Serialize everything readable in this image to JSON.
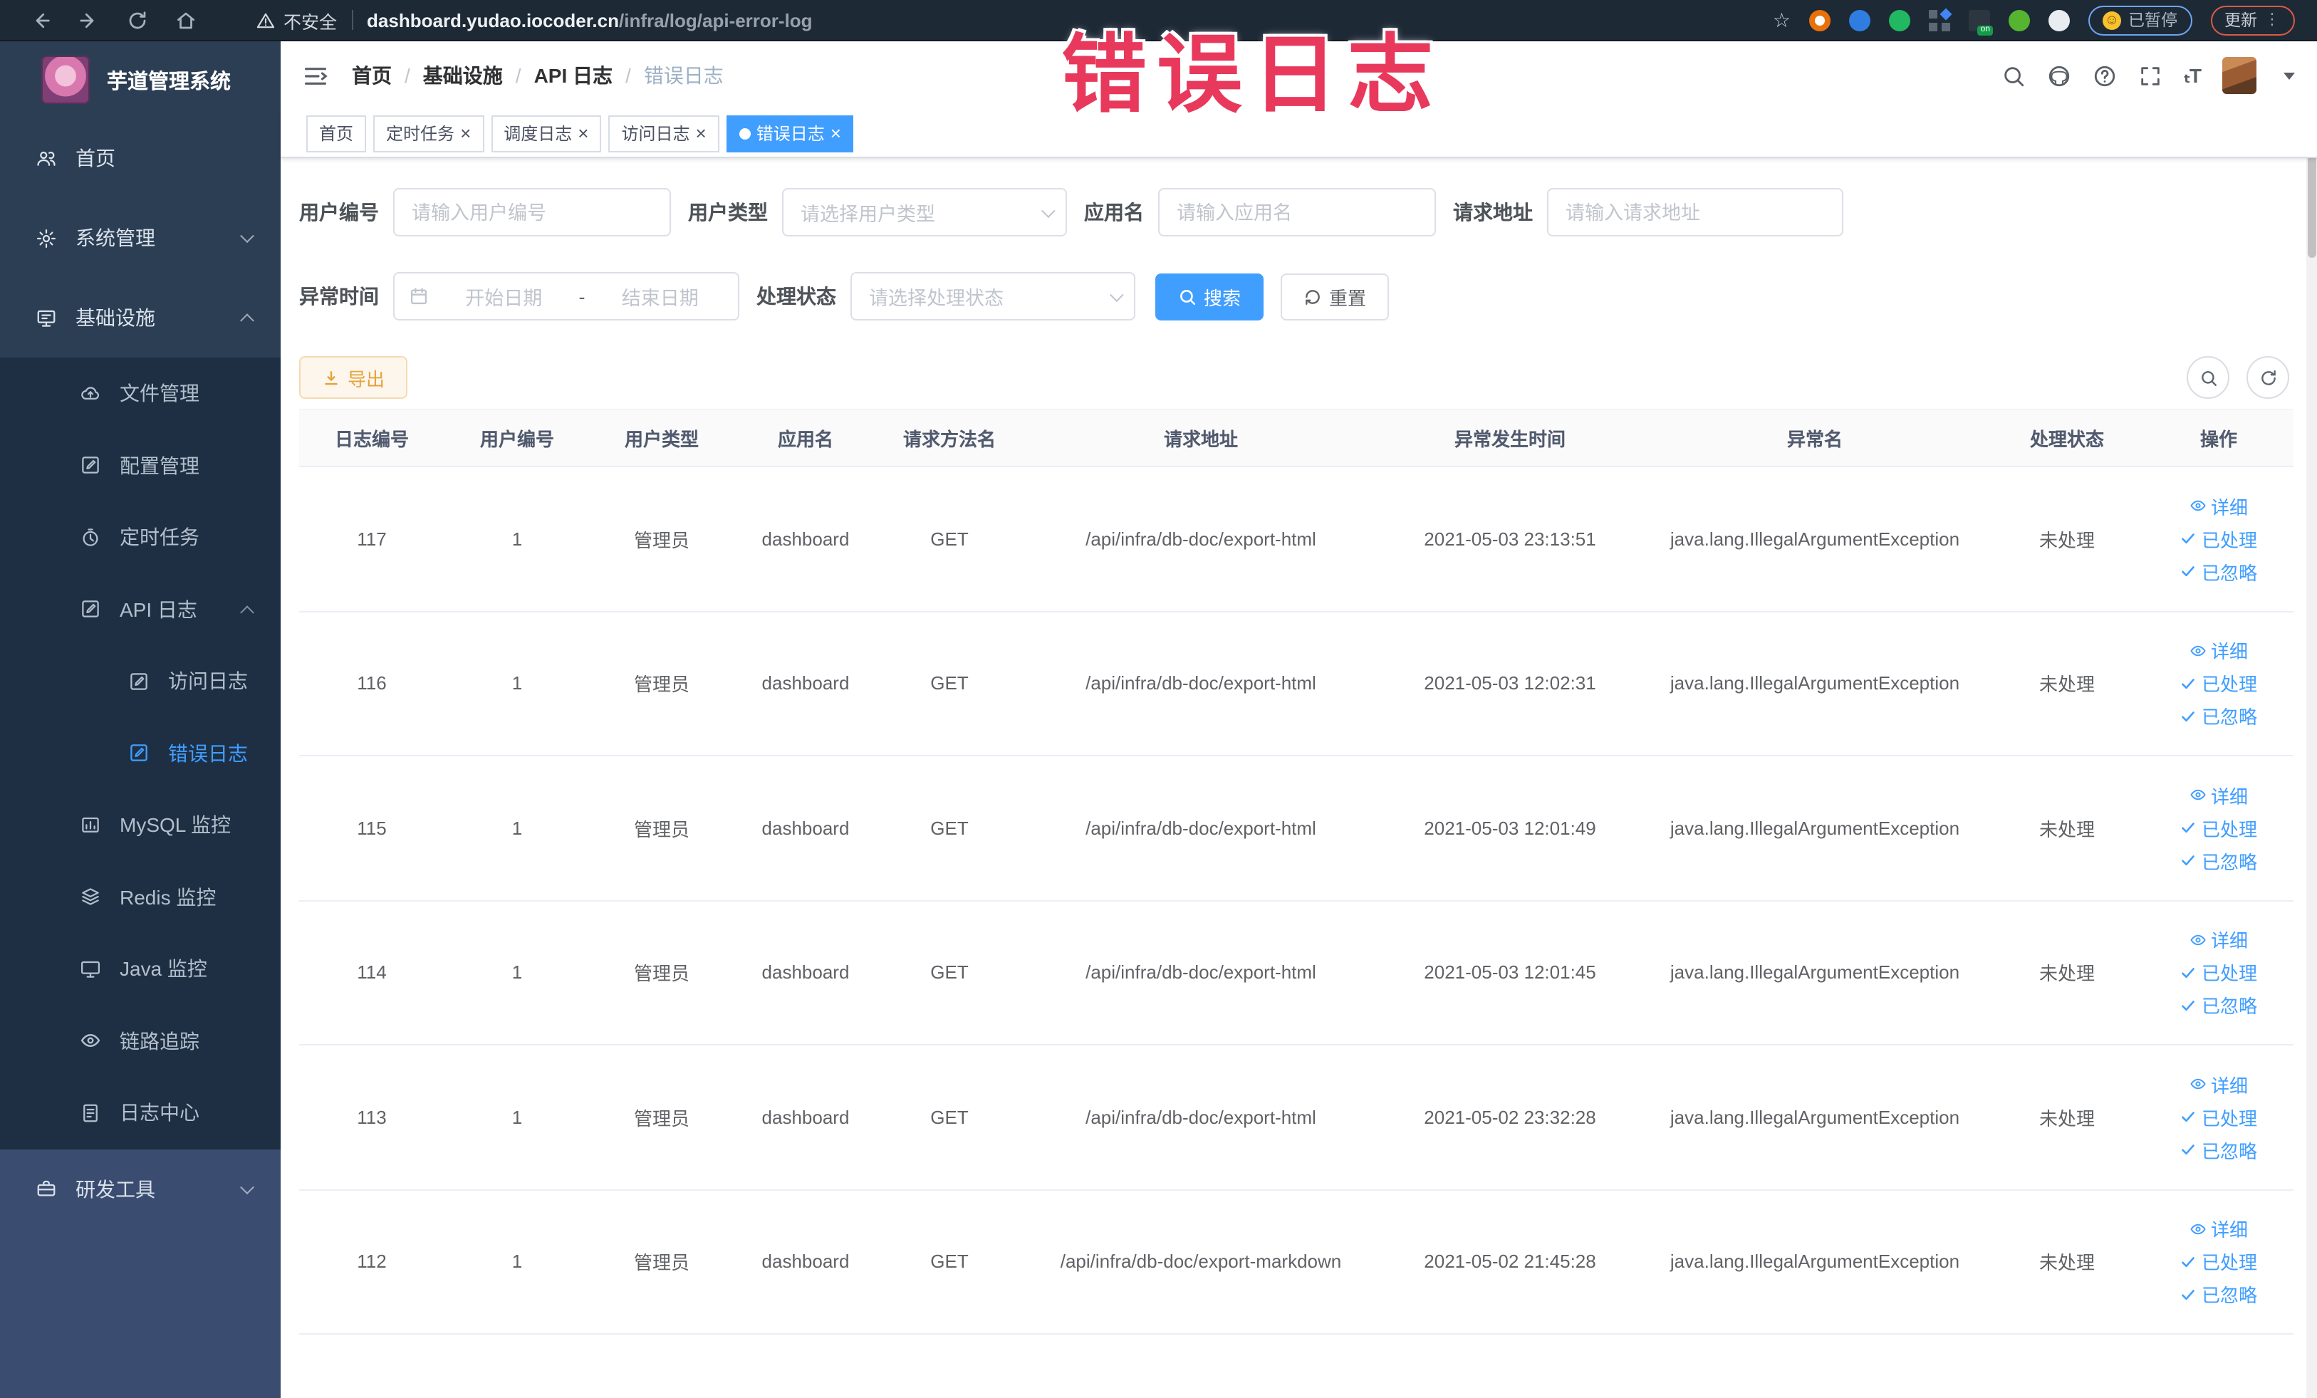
{
  "browser": {
    "security_warning": "不安全",
    "url_host": "dashboard.yudao.iocoder.cn",
    "url_path": "/infra/log/api-error-log",
    "paused_label": "已暂停",
    "update_label": "更新",
    "extensions": [
      {
        "name": "orange-ring-extension-icon",
        "color": "#e8710a",
        "style": "ring"
      },
      {
        "name": "blue-shield-extension-icon",
        "color": "#2f7de1",
        "style": "circle"
      },
      {
        "name": "green-circle-extension-icon",
        "color": "#22b862",
        "style": "circle"
      },
      {
        "name": "grid-extension-icon",
        "color": "#4285f4",
        "style": "grid"
      },
      {
        "name": "proxy-on-extension-icon",
        "color": "#139b48",
        "style": "switch"
      },
      {
        "name": "green-leaf-extension-icon",
        "color": "#55b531",
        "style": "circle"
      },
      {
        "name": "paw-extension-icon",
        "color": "#e9edf2",
        "style": "circle"
      }
    ]
  },
  "annotation": {
    "text": "错误日志",
    "color": "#e8395c"
  },
  "sidebar": {
    "title": "芋道管理系统",
    "items": [
      {
        "name": "sidebar-item-home",
        "label": "首页",
        "icon": "home-icon",
        "level": 1
      },
      {
        "name": "sidebar-item-system",
        "label": "系统管理",
        "icon": "gear-icon",
        "level": 1,
        "chevron": "down"
      },
      {
        "name": "sidebar-item-infra",
        "label": "基础设施",
        "icon": "infra-icon",
        "level": 1,
        "chevron": "up"
      },
      {
        "name": "sidebar-item-file",
        "label": "文件管理",
        "icon": "cloud-icon",
        "level": 2
      },
      {
        "name": "sidebar-item-config",
        "label": "配置管理",
        "icon": "edit-icon",
        "level": 2
      },
      {
        "name": "sidebar-item-job",
        "label": "定时任务",
        "icon": "timer-icon",
        "level": 2
      },
      {
        "name": "sidebar-item-api-log",
        "label": "API 日志",
        "icon": "edit-icon",
        "level": 2,
        "chevron": "up"
      },
      {
        "name": "sidebar-item-access-log",
        "label": "访问日志",
        "icon": "edit-icon",
        "level": 3
      },
      {
        "name": "sidebar-item-error-log",
        "label": "错误日志",
        "icon": "edit-icon",
        "level": 3,
        "active": true
      },
      {
        "name": "sidebar-item-mysql",
        "label": "MySQL 监控",
        "icon": "chart-icon",
        "level": 2
      },
      {
        "name": "sidebar-item-redis",
        "label": "Redis 监控",
        "icon": "layers-icon",
        "level": 2
      },
      {
        "name": "sidebar-item-java",
        "label": "Java 监控",
        "icon": "monitor-icon",
        "level": 2
      },
      {
        "name": "sidebar-item-trace",
        "label": "链路追踪",
        "icon": "eye-icon",
        "level": 2
      },
      {
        "name": "sidebar-item-log-center",
        "label": "日志中心",
        "icon": "doc-icon",
        "level": 2
      },
      {
        "name": "sidebar-item-dev-tools",
        "label": "研发工具",
        "icon": "toolbox-icon",
        "level": 1,
        "chevron": "down",
        "section": "bottom"
      }
    ]
  },
  "breadcrumb": {
    "items": [
      "首页",
      "基础设施",
      "API 日志",
      "错误日志"
    ],
    "separator": "/"
  },
  "tags": [
    {
      "label": "首页",
      "closable": false,
      "active": false
    },
    {
      "label": "定时任务",
      "closable": true,
      "active": false
    },
    {
      "label": "调度日志",
      "closable": true,
      "active": false
    },
    {
      "label": "访问日志",
      "closable": true,
      "active": false
    },
    {
      "label": "错误日志",
      "closable": true,
      "active": true
    }
  ],
  "filters": {
    "user_id": {
      "label": "用户编号",
      "placeholder": "请输入用户编号"
    },
    "user_type": {
      "label": "用户类型",
      "placeholder": "请选择用户类型"
    },
    "app_name": {
      "label": "应用名",
      "placeholder": "请输入应用名"
    },
    "request_url": {
      "label": "请求地址",
      "placeholder": "请输入请求地址"
    },
    "exception_time": {
      "label": "异常时间",
      "start_placeholder": "开始日期",
      "separator": "-",
      "end_placeholder": "结束日期"
    },
    "process_status": {
      "label": "处理状态",
      "placeholder": "请选择处理状态"
    },
    "search_label": "搜索",
    "reset_label": "重置"
  },
  "toolbar": {
    "export_label": "导出"
  },
  "table": {
    "columns": [
      "日志编号",
      "用户编号",
      "用户类型",
      "应用名",
      "请求方法名",
      "请求地址",
      "异常发生时间",
      "异常名",
      "处理状态",
      "操作"
    ],
    "rows": [
      [
        "117",
        "1",
        "管理员",
        "dashboard",
        "GET",
        "/api/infra/db-doc/export-html",
        "2021-05-03 23:13:51",
        "java.lang.IllegalArgumentException",
        "未处理"
      ],
      [
        "116",
        "1",
        "管理员",
        "dashboard",
        "GET",
        "/api/infra/db-doc/export-html",
        "2021-05-03 12:02:31",
        "java.lang.IllegalArgumentException",
        "未处理"
      ],
      [
        "115",
        "1",
        "管理员",
        "dashboard",
        "GET",
        "/api/infra/db-doc/export-html",
        "2021-05-03 12:01:49",
        "java.lang.IllegalArgumentException",
        "未处理"
      ],
      [
        "114",
        "1",
        "管理员",
        "dashboard",
        "GET",
        "/api/infra/db-doc/export-html",
        "2021-05-03 12:01:45",
        "java.lang.IllegalArgumentException",
        "未处理"
      ],
      [
        "113",
        "1",
        "管理员",
        "dashboard",
        "GET",
        "/api/infra/db-doc/export-html",
        "2021-05-02 23:32:28",
        "java.lang.IllegalArgumentException",
        "未处理"
      ],
      [
        "112",
        "1",
        "管理员",
        "dashboard",
        "GET",
        "/api/infra/db-doc/export-markdown",
        "2021-05-02 21:45:28",
        "java.lang.IllegalArgumentException",
        "未处理"
      ]
    ],
    "row_actions": [
      {
        "name": "detail-link",
        "icon": "eye-icon",
        "label": "详细"
      },
      {
        "name": "processed-link",
        "icon": "check-icon",
        "label": "已处理"
      },
      {
        "name": "ignored-link",
        "icon": "check-icon",
        "label": "已忽略"
      }
    ]
  },
  "colors": {
    "primary": "#409eff",
    "warning": "#e6a23c",
    "sidebar_active": "#409eff"
  }
}
